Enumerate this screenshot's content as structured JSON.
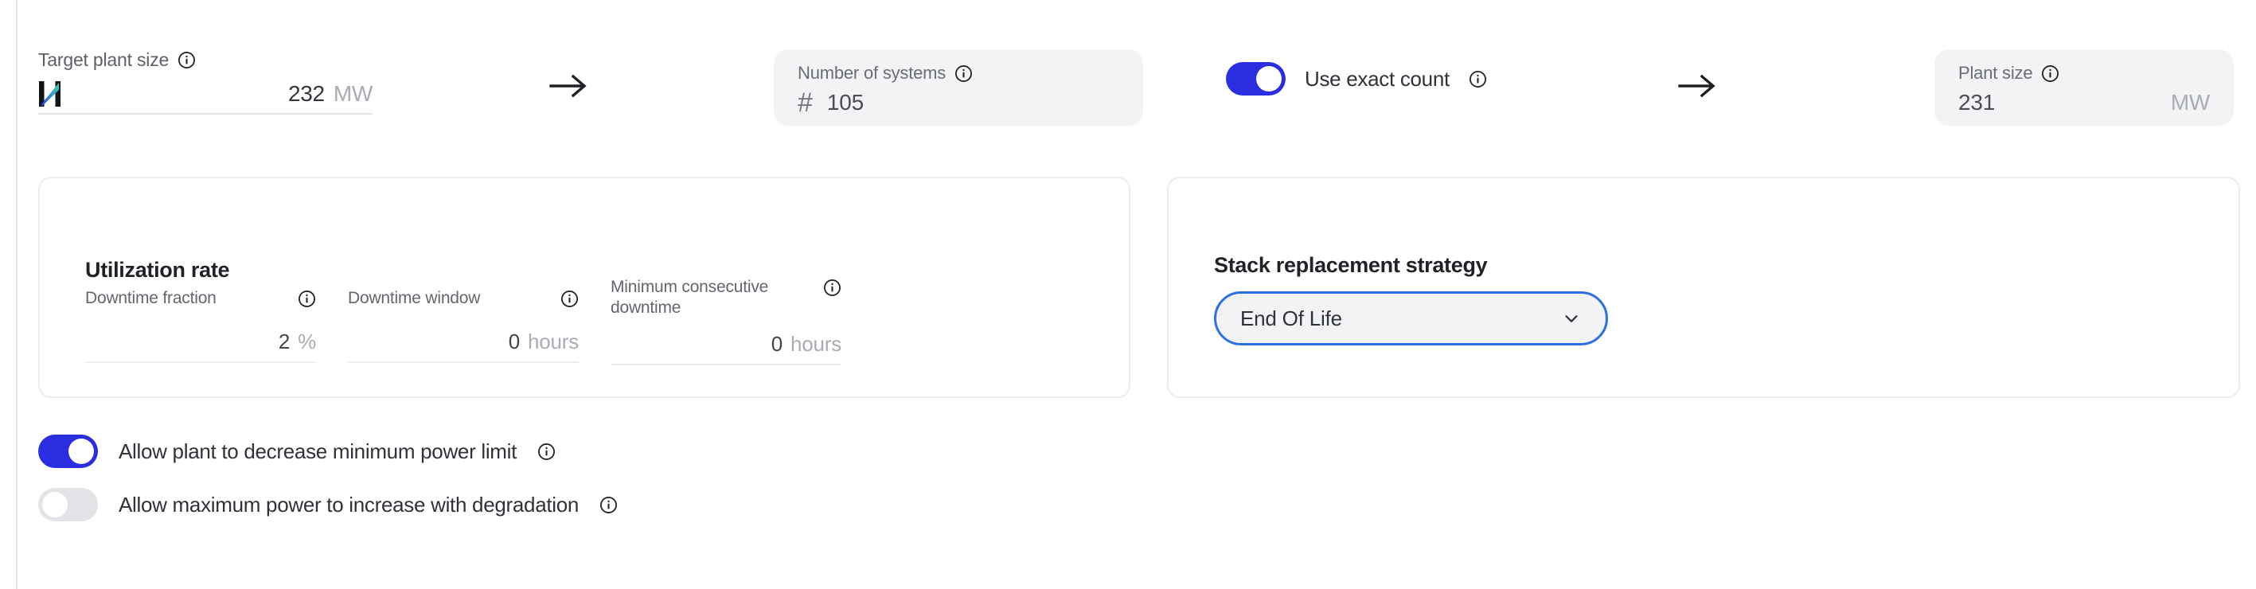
{
  "colors": {
    "toggle_on": "#2b2ee0",
    "toggle_off": "#e2e3e7",
    "select_focus_border": "#2f6fe4",
    "card_border": "#ebecef",
    "box_fill": "#f2f3f5"
  },
  "row1": {
    "target_plant_size": {
      "label": "Target plant size",
      "info_icon": "info-icon",
      "brand_icon": "h-logo-icon",
      "value": "232",
      "unit": "MW"
    },
    "arrow1_icon": "arrow-right-icon",
    "number_of_systems": {
      "label": "Number of systems",
      "info_icon": "info-icon",
      "hash_icon": "#",
      "value": "105"
    },
    "use_exact_count": {
      "label": "Use exact count",
      "info_icon": "info-icon",
      "state": "on"
    },
    "arrow2_icon": "arrow-right-icon",
    "plant_size": {
      "label": "Plant size",
      "info_icon": "info-icon",
      "value": "231",
      "unit": "MW"
    }
  },
  "utilization_card": {
    "title": "Utilization rate",
    "fields": [
      {
        "label": "Downtime fraction",
        "info_icon": "info-icon",
        "value": "2",
        "unit": "%"
      },
      {
        "label": "Downtime window",
        "info_icon": "info-icon",
        "value": "0",
        "unit": "hours"
      },
      {
        "label": "Minimum consecutive downtime",
        "info_icon": "info-icon",
        "value": "0",
        "unit": "hours"
      }
    ]
  },
  "strategy_card": {
    "title": "Stack replacement strategy",
    "select": {
      "value": "End Of Life",
      "chevron_icon": "chevron-down-icon"
    }
  },
  "bottom_toggles": [
    {
      "label": "Allow plant to decrease minimum power limit",
      "info_icon": "info-icon",
      "state": "on"
    },
    {
      "label": "Allow maximum power to increase with degradation",
      "info_icon": "info-icon",
      "state": "off"
    }
  ]
}
